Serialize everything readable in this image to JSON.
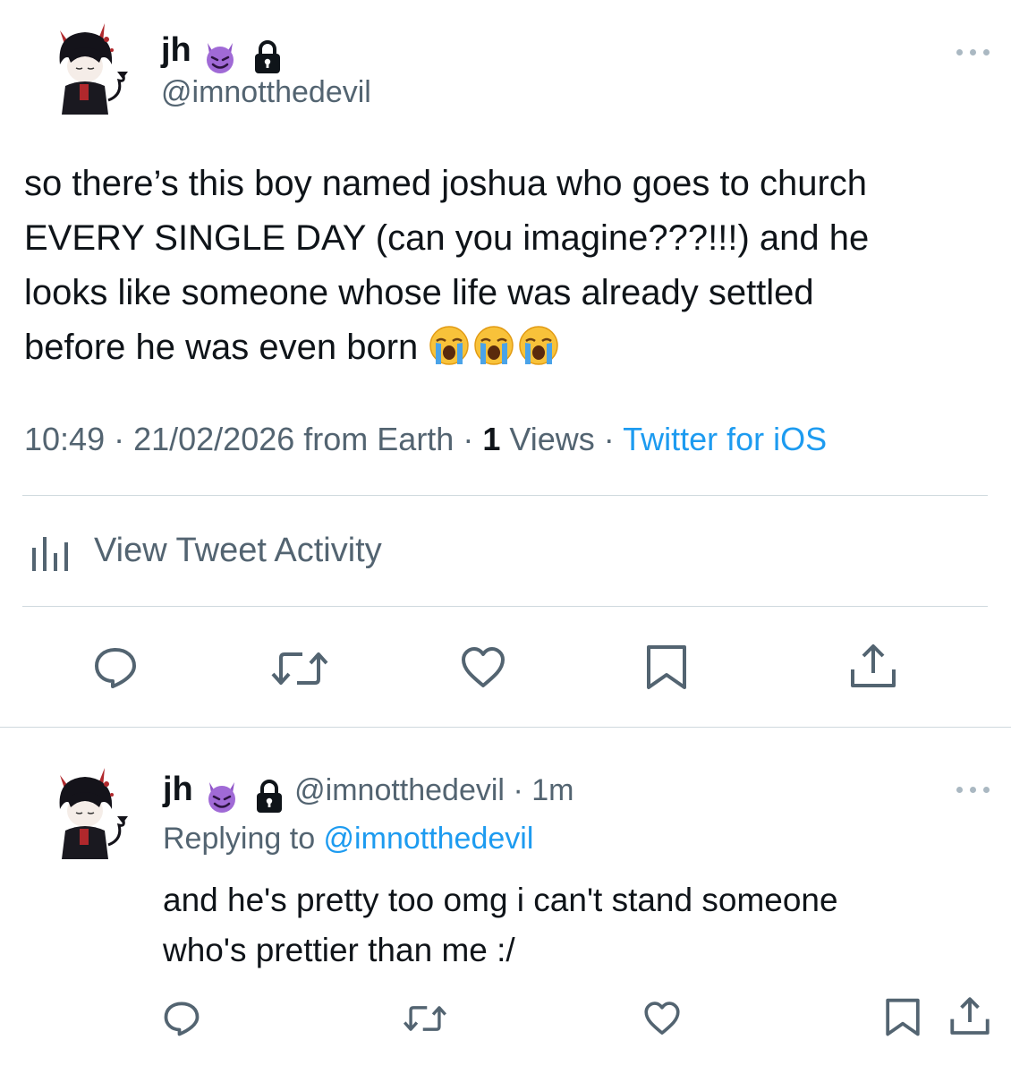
{
  "tweet": {
    "author_name": "jh",
    "handle": "@imnotthedevil",
    "body_line1": "so there’s this boy named joshua who goes to church",
    "body_line2": "EVERY SINGLE DAY (can you imagine???!!!) and he",
    "body_line3": "looks like someone whose life was already settled",
    "body_line4": "before he was even born",
    "time": "10:49",
    "sep1": " · ",
    "date": "21/02/2026",
    "location": " from Earth",
    "sep2": " · ",
    "views_count": "1",
    "views_label": " Views",
    "sep3": " · ",
    "client": "Twitter for iOS",
    "activity_label": "View Tweet Activity"
  },
  "reply": {
    "author_name": "jh",
    "handle": "@imnotthedevil",
    "sep": " · ",
    "age": "1m",
    "replying_prefix": "Replying to ",
    "replying_to": "@imnotthedevil",
    "body_line1": "and he's pretty too omg i can't stand someone",
    "body_line2": "who's prettier than me :/"
  },
  "icons": {
    "badge": "smiling-devil-emoji",
    "protected": "lock-icon",
    "crying": "loudly-crying-face-emoji",
    "actions": [
      "reply-icon",
      "retweet-icon",
      "like-icon",
      "bookmark-icon",
      "share-icon"
    ]
  },
  "colors": {
    "link": "#1d9bf0",
    "muted": "#536471",
    "divider": "#cfd9de",
    "text": "#0f1419"
  }
}
